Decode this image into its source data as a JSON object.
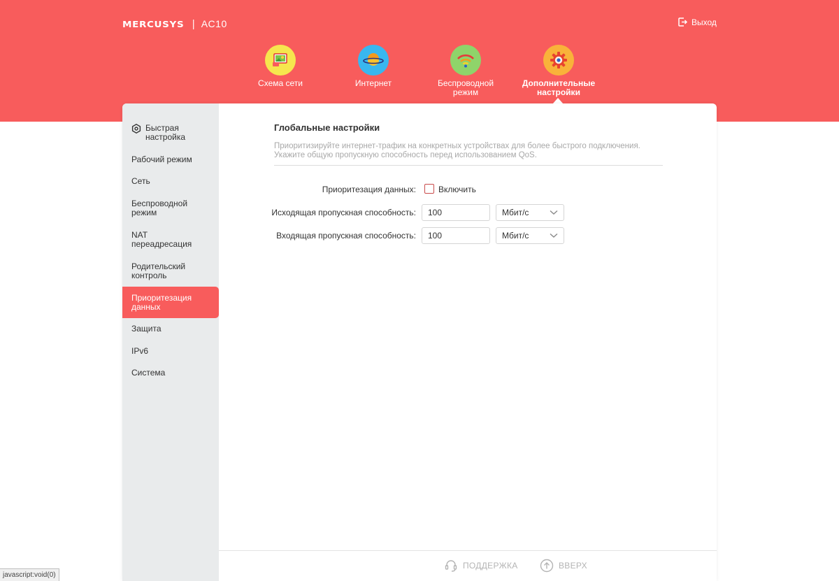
{
  "header": {
    "brand": "MERCUSYS",
    "separator": "|",
    "model": "AC10",
    "logout_label": "Выход"
  },
  "nav": [
    {
      "label_line1": "Схема сети",
      "label_line2": "",
      "icon": "network-map-icon",
      "color": "#f6e64e"
    },
    {
      "label_line1": "Интернет",
      "label_line2": "",
      "icon": "internet-planet-icon",
      "color": "#39b7ef"
    },
    {
      "label_line1": "Беспроводной",
      "label_line2": "режим",
      "icon": "wifi-icon",
      "color": "#8fd46a"
    },
    {
      "label_line1": "Дополнительные",
      "label_line2": "настройки",
      "icon": "gear-icon",
      "color": "#f9b23a",
      "active": true
    }
  ],
  "sidebar": {
    "items": [
      {
        "line1": "Быстрая",
        "line2": "настройка"
      },
      {
        "line1": "Рабочий режим",
        "line2": ""
      },
      {
        "line1": "Сеть",
        "line2": ""
      },
      {
        "line1": "Беспроводной",
        "line2": "режим"
      },
      {
        "line1": "NAT",
        "line2": "переадресация"
      },
      {
        "line1": "Родительский",
        "line2": "контроль"
      },
      {
        "line1": "Приоритезация",
        "line2": "данных",
        "active": true
      },
      {
        "line1": "Защита",
        "line2": ""
      },
      {
        "line1": "IPv6",
        "line2": ""
      },
      {
        "line1": "Система",
        "line2": ""
      }
    ]
  },
  "main": {
    "title": "Глобальные настройки",
    "desc_line1": "Приоритизируйте интернет-трафик на конкретных устройствах для более быстрого подключения.",
    "desc_line2": "Укажите общую пропускную способность перед использованием QoS.",
    "qos_label": "Приоритезация данных:",
    "qos_checkbox_label": "Включить",
    "qos_enabled": false,
    "upload_label": "Исходящая пропускная способность:",
    "upload_value": "100",
    "upload_unit": "Мбит/с",
    "download_label": "Входящая пропускная способность:",
    "download_value": "100",
    "download_unit": "Мбит/с"
  },
  "footer": {
    "support_label": "ПОДДЕРЖКА",
    "top_label": "ВВЕРХ"
  },
  "status_bar": "javascript:void(0)",
  "colors": {
    "accent": "#f85c5c",
    "sidebar_bg": "#e9ebec",
    "muted_text": "#a8a8a8"
  }
}
